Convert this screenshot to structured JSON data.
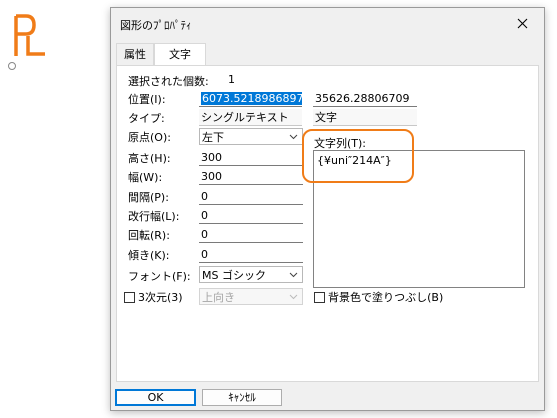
{
  "dialog": {
    "title": "図形のﾌﾟﾛﾊﾟﾃｨ",
    "tabs": [
      "属性",
      "文字"
    ],
    "selected_count_label": "選択された個数:",
    "selected_count": "1",
    "labels": {
      "position": "位置(I):",
      "type": "タイプ:",
      "origin": "原点(O):",
      "height": "高さ(H):",
      "width": "幅(W):",
      "spacing": "間隔(P):",
      "line_spacing": "改行幅(L):",
      "rotation": "回転(R):",
      "slant": "傾き(K):",
      "font": "フォント(F):",
      "string": "文字列(T):"
    },
    "values": {
      "position_x": "6073.5218986897",
      "position_y": "35626.28806709",
      "type": "シングルテキスト",
      "type_kind": "文字",
      "origin": "左下",
      "height": "300",
      "width": "300",
      "spacing": "0",
      "line_spacing": "0",
      "rotation": "0",
      "slant": "0",
      "font": "MS ゴシック",
      "string": "{¥uni″214A″}",
      "three_d_label": "3次元(3)",
      "three_d_direction": "上向き",
      "background_fill_label": "背景色で塗りつぶし(B)"
    },
    "buttons": {
      "ok": "OK",
      "cancel": "ｷｬﾝｾﾙ"
    },
    "colors": {
      "accent": "#0078d7",
      "highlight": "#f07c18",
      "logo": "#f07c18"
    }
  }
}
